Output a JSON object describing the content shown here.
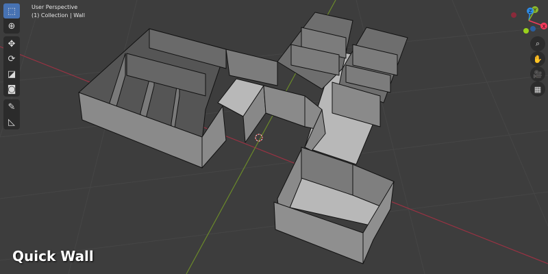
{
  "viewport": {
    "view_name": "User Perspective",
    "collection_info": "(1) Collection | Wall"
  },
  "toolbar": [
    {
      "name": "select-box",
      "icon": "select-box-icon",
      "active": true
    },
    {
      "name": "cursor",
      "icon": "cursor-icon"
    },
    {
      "name": "move",
      "icon": "move-icon"
    },
    {
      "name": "rotate",
      "icon": "rotate-icon"
    },
    {
      "name": "scale",
      "icon": "scale-icon"
    },
    {
      "name": "transform",
      "icon": "transform-icon"
    },
    {
      "name": "annotate",
      "icon": "annotate-icon"
    },
    {
      "name": "measure",
      "icon": "measure-icon"
    }
  ],
  "gizmo": {
    "x": "X",
    "y": "Y",
    "z": "Z",
    "colors": {
      "x": "#f5395b",
      "y": "#8bb72c",
      "z": "#2e8ce8"
    }
  },
  "nav_buttons": [
    {
      "name": "zoom",
      "icon": "zoom-icon"
    },
    {
      "name": "pan",
      "icon": "hand-icon"
    },
    {
      "name": "camera",
      "icon": "camera-icon"
    },
    {
      "name": "ortho",
      "icon": "grid-icon"
    }
  ],
  "caption": "Quick Wall"
}
